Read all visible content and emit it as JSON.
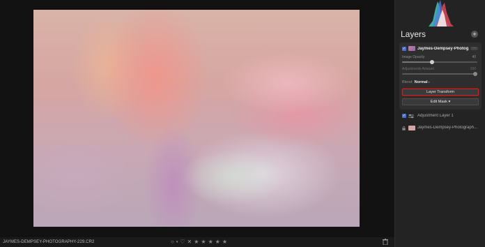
{
  "statusbar": {
    "filename": "JAYMES-DEMPSEY-PHOTOGRAPHY-229.CR2",
    "rating_stars": 5
  },
  "panel": {
    "title": "Layers",
    "active_layer": {
      "name": "Jaymes-Dempsey-Photog...",
      "more": "···",
      "image_opacity_label": "Image Opacity",
      "image_opacity_value": "40",
      "image_opacity_fraction": 0.4,
      "adjustments_amount_label": "Adjustments Amount",
      "adjustments_amount_value": "100",
      "adjustments_amount_fraction": 1.0,
      "blend_label": "Blend:",
      "blend_value": "Normal",
      "layer_transform_label": "Layer Transform",
      "edit_mask_label": "Edit Mask ▾"
    },
    "layers": [
      {
        "name": "Adjustment Layer 1",
        "type": "adjustment"
      },
      {
        "name": "Jaymes-Dempsey-Photograph...",
        "type": "locked-image"
      }
    ]
  },
  "colors": {
    "accent_checkbox": "#4a6fd1",
    "highlight_border": "#c0282a",
    "panel_bg": "#232323"
  }
}
